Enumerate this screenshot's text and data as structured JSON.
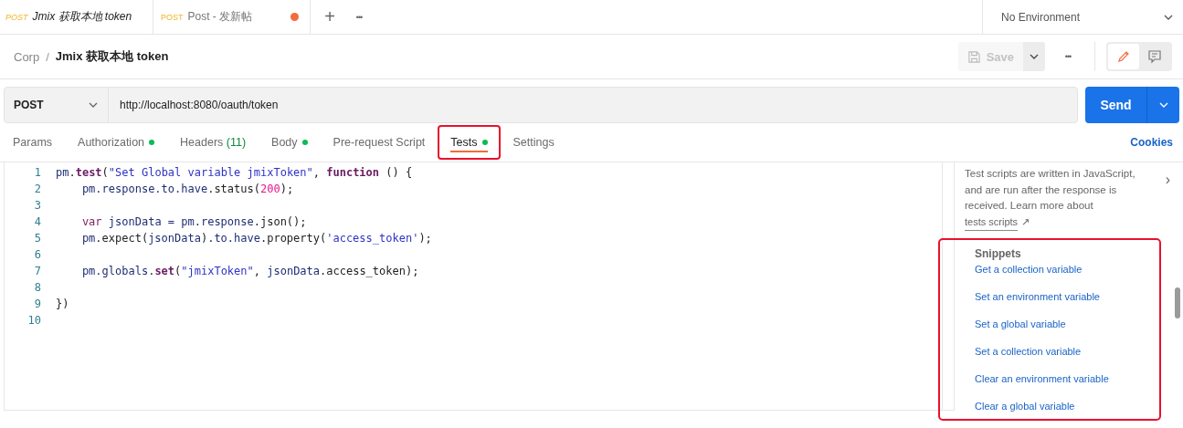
{
  "request_tabs": [
    {
      "method": "POST",
      "name": "Jmix 获取本地 token",
      "selected": true,
      "preview": true,
      "unsaved": false
    },
    {
      "method": "POST",
      "name": "Post - 发新帖",
      "selected": false,
      "preview": false,
      "unsaved": true
    }
  ],
  "tab_actions": {
    "new": "+",
    "more": "•••"
  },
  "environment": {
    "label": "No Environment"
  },
  "breadcrumb": {
    "parent": "Corp",
    "separator": "/",
    "current": "Jmix 获取本地 token"
  },
  "toolbar": {
    "save": {
      "label": "Save",
      "disabled": true
    },
    "more": "•••",
    "view_toggle": [
      {
        "kind": "edit",
        "selected": true
      },
      {
        "kind": "comments",
        "selected": false
      }
    ]
  },
  "url_bar": {
    "method": "POST",
    "url": "http://localhost:8080/oauth/token",
    "send": "Send"
  },
  "section_tabs": [
    {
      "label": "Params",
      "dot": false,
      "selected": false,
      "highlighted": false
    },
    {
      "label": "Authorization",
      "dot": true,
      "selected": false,
      "highlighted": false
    },
    {
      "label": "Headers",
      "count": "(11)",
      "dot": false,
      "selected": false,
      "highlighted": false
    },
    {
      "label": "Body",
      "dot": true,
      "selected": false,
      "highlighted": false
    },
    {
      "label": "Pre-request Script",
      "dot": false,
      "selected": false,
      "highlighted": false
    },
    {
      "label": "Tests",
      "dot": true,
      "selected": true,
      "highlighted": true
    },
    {
      "label": "Settings",
      "dot": false,
      "selected": false,
      "highlighted": false
    }
  ],
  "cookies": "Cookies",
  "editor": {
    "lines": [
      {
        "number": "1",
        "tokens": [
          {
            "text": "pm",
            "kind": "obj"
          },
          {
            "text": ".",
            "kind": "plain"
          },
          {
            "text": "test",
            "kind": "method"
          },
          {
            "text": "(",
            "kind": "plain"
          },
          {
            "text": "\"Set Global variable jmixToken\"",
            "kind": "string"
          },
          {
            "text": ", ",
            "kind": "plain"
          },
          {
            "text": "function",
            "kind": "keyword"
          },
          {
            "text": " () {",
            "kind": "plain"
          }
        ]
      },
      {
        "number": "2",
        "indent": true,
        "tokens": [
          {
            "text": "pm.response.to.have",
            "kind": "obj"
          },
          {
            "text": ".status(",
            "kind": "plain"
          },
          {
            "text": "200",
            "kind": "number"
          },
          {
            "text": ");",
            "kind": "plain"
          }
        ]
      },
      {
        "number": "3"
      },
      {
        "number": "4",
        "indent": true,
        "tokens": [
          {
            "text": "var",
            "kind": "var"
          },
          {
            "text": " jsonData = pm.response",
            "kind": "obj"
          },
          {
            "text": ".json();",
            "kind": "plain"
          }
        ]
      },
      {
        "number": "5",
        "indent": true,
        "tokens": [
          {
            "text": "pm",
            "kind": "obj"
          },
          {
            "text": ".expect(",
            "kind": "plain"
          },
          {
            "text": "jsonData",
            "kind": "obj"
          },
          {
            "text": ").",
            "kind": "plain"
          },
          {
            "text": "to.have",
            "kind": "obj"
          },
          {
            "text": ".property(",
            "kind": "plain"
          },
          {
            "text": "'access_token'",
            "kind": "string"
          },
          {
            "text": ");",
            "kind": "plain"
          }
        ]
      },
      {
        "number": "6"
      },
      {
        "number": "7",
        "indent": true,
        "tokens": [
          {
            "text": "pm.globals",
            "kind": "obj"
          },
          {
            "text": ".",
            "kind": "plain"
          },
          {
            "text": "set",
            "kind": "method"
          },
          {
            "text": "(",
            "kind": "plain"
          },
          {
            "text": "\"jmixToken\"",
            "kind": "string"
          },
          {
            "text": ", ",
            "kind": "plain"
          },
          {
            "text": "jsonData",
            "kind": "obj"
          },
          {
            "text": ".access_token);",
            "kind": "plain"
          }
        ]
      },
      {
        "number": "8"
      },
      {
        "number": "9",
        "tokens": [
          {
            "text": "})",
            "kind": "plain"
          }
        ]
      },
      {
        "number": "10"
      }
    ]
  },
  "side_panel": {
    "description": "Test scripts are written in JavaScript, and are run after the response is received. Learn more about",
    "link": "tests scripts",
    "link_arrow": "↗",
    "collapse": "›",
    "snippets": {
      "title": "Snippets",
      "highlighted": true,
      "items": [
        "Get a collection variable",
        "Set an environment variable",
        "Set a global variable",
        "Set a collection variable",
        "Clear an environment variable",
        "Clear a global variable"
      ]
    }
  }
}
